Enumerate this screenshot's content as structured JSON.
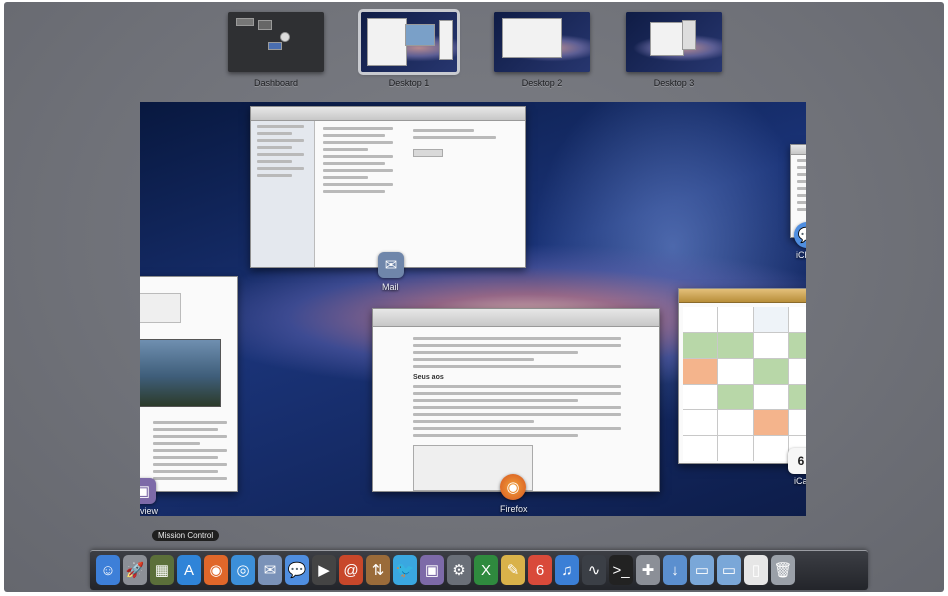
{
  "spaces": [
    {
      "label": "Dashboard"
    },
    {
      "label": "Desktop 1"
    },
    {
      "label": "Desktop 2"
    },
    {
      "label": "Desktop 3"
    }
  ],
  "windows": {
    "mail_label": "Mail",
    "ichat_label": "iChat",
    "preview_label": "Preview",
    "firefox_label": "Firefox",
    "document_heading": "Seus aos",
    "ical_label": "iCal"
  },
  "ical": {
    "date_badge": "6"
  },
  "tooltip": "Mission Control",
  "dock": {
    "items": [
      {
        "icon": "finder-icon",
        "glyph": "☺",
        "color": "#3d7fd8"
      },
      {
        "icon": "launchpad-icon",
        "glyph": "🚀",
        "color": "#8c8f96"
      },
      {
        "icon": "mission-control-icon",
        "glyph": "▦",
        "color": "#5b6f3a"
      },
      {
        "icon": "app-store-icon",
        "glyph": "A",
        "color": "#2f84d8"
      },
      {
        "icon": "firefox-icon",
        "glyph": "◉",
        "color": "#e0672a"
      },
      {
        "icon": "safari-icon",
        "glyph": "◎",
        "color": "#3c8fd9"
      },
      {
        "icon": "mail-icon",
        "glyph": "✉",
        "color": "#7a92b8"
      },
      {
        "icon": "ichat-icon",
        "glyph": "💬",
        "color": "#4f8ee0"
      },
      {
        "icon": "facetime-icon",
        "glyph": "▶",
        "color": "#444"
      },
      {
        "icon": "address-book-icon",
        "glyph": "@",
        "color": "#c8472a"
      },
      {
        "icon": "transmit-icon",
        "glyph": "⇅",
        "color": "#9a6b3a"
      },
      {
        "icon": "twitter-icon",
        "glyph": "🐦",
        "color": "#3aa7e0"
      },
      {
        "icon": "preview-icon",
        "glyph": "▣",
        "color": "#7d6aa8"
      },
      {
        "icon": "tools-icon",
        "glyph": "⚙",
        "color": "#6a6f78"
      },
      {
        "icon": "excel-icon",
        "glyph": "X",
        "color": "#2f8a3e"
      },
      {
        "icon": "notes-icon",
        "glyph": "✎",
        "color": "#d9b24a"
      },
      {
        "icon": "calendar-icon",
        "glyph": "6",
        "color": "#d94a3a"
      },
      {
        "icon": "itunes-icon",
        "glyph": "♫",
        "color": "#3b7fd6"
      },
      {
        "icon": "activity-monitor-icon",
        "glyph": "∿",
        "color": "#3b3f46"
      },
      {
        "icon": "terminal-icon",
        "glyph": ">_",
        "color": "#222"
      },
      {
        "icon": "photos-icon",
        "glyph": "✚",
        "color": "#8b8f97"
      },
      {
        "icon": "downloads-stack-icon",
        "glyph": "↓",
        "color": "#5b8fcf"
      },
      {
        "icon": "documents-folder-icon",
        "glyph": "▭",
        "color": "#7aa7d8"
      },
      {
        "icon": "applications-folder-icon",
        "glyph": "▭",
        "color": "#7aa7d8"
      },
      {
        "icon": "document-stack-icon",
        "glyph": "▯",
        "color": "#e6e6e6"
      },
      {
        "icon": "trash-icon",
        "glyph": "🗑",
        "color": "#9aa0a8"
      }
    ]
  },
  "colors": {
    "dock_bg": "#2a2c31",
    "desktop_bg": "#1a3377",
    "ical_header": "#c9a03f"
  }
}
